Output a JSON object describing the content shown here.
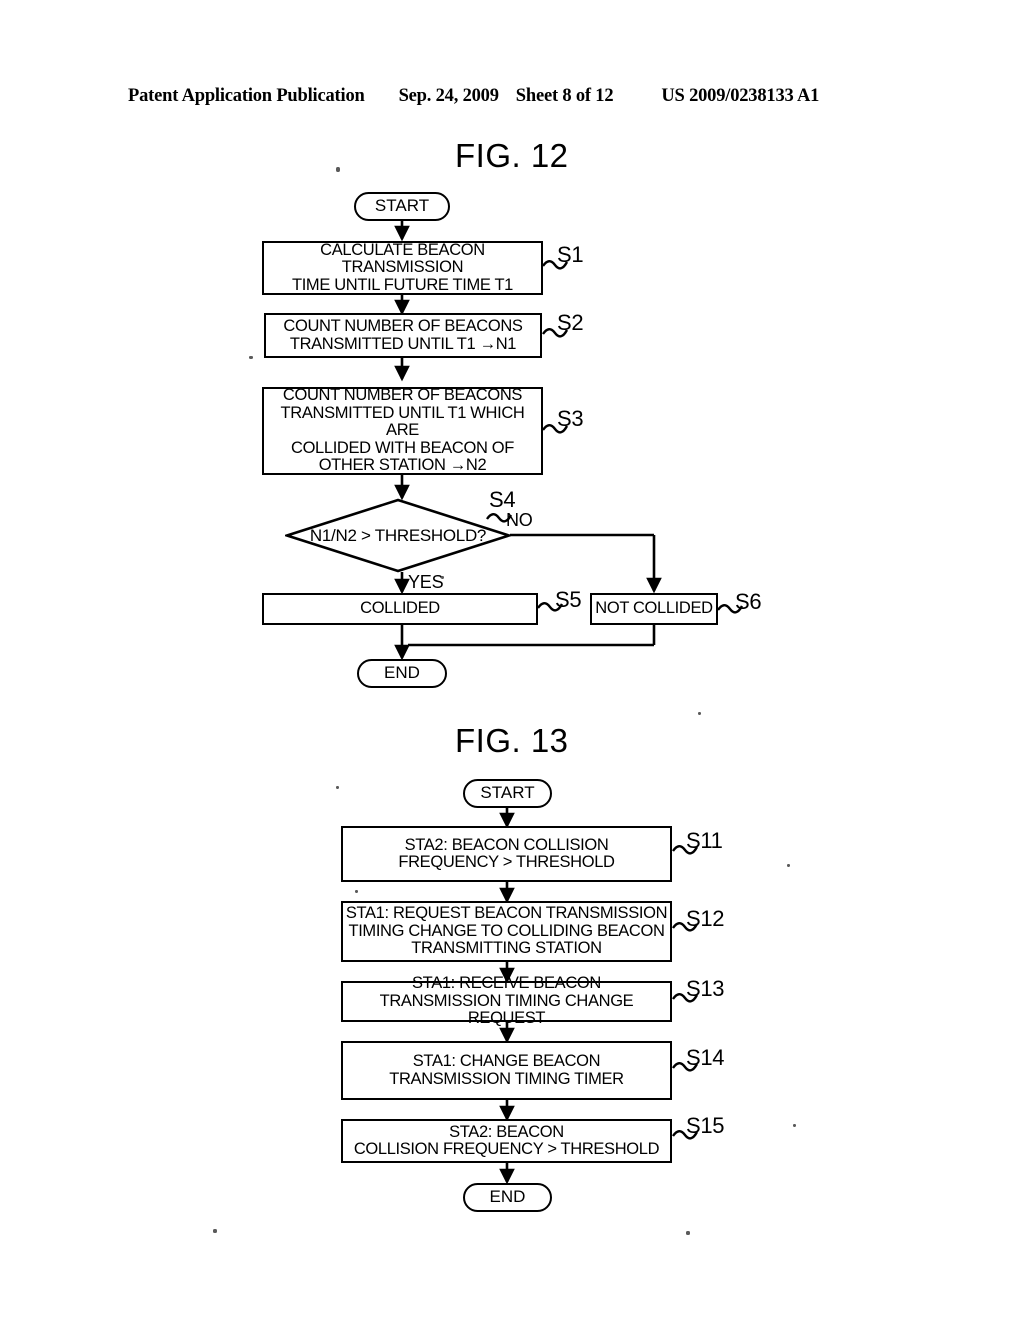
{
  "header": {
    "publication": "Patent Application Publication",
    "date": "Sep. 24, 2009",
    "sheet": "Sheet 8 of 12",
    "doc_number": "US 2009/0238133 A1"
  },
  "figures": [
    {
      "id": "fig12",
      "title": "FIG. 12",
      "nodes": {
        "start": "START",
        "s1": "CALCULATE BEACON TRANSMISSION\nTIME UNTIL FUTURE TIME T1",
        "s2": "COUNT NUMBER OF BEACONS\nTRANSMITTED UNTIL T1 →N1",
        "s3": "COUNT NUMBER OF BEACONS\nTRANSMITTED UNTIL T1 WHICH ARE\nCOLLIDED WITH BEACON OF\nOTHER STATION →N2",
        "s4": "N1/N2 > THRESHOLD?",
        "s5": "COLLIDED",
        "s6": "NOT COLLIDED",
        "end": "END"
      },
      "step_refs": {
        "s1": "S1",
        "s2": "S2",
        "s3": "S3",
        "s4": "S4",
        "s5": "S5",
        "s6": "S6"
      },
      "branches": {
        "yes": "YES",
        "no": "NO"
      }
    },
    {
      "id": "fig13",
      "title": "FIG. 13",
      "nodes": {
        "start": "START",
        "s11": "STA2: BEACON COLLISION\nFREQUENCY > THRESHOLD",
        "s12": "STA1: REQUEST BEACON TRANSMISSION\nTIMING CHANGE TO COLLIDING BEACON\nTRANSMITTING STATION",
        "s13": "STA1: RECEIVE BEACON\nTRANSMISSION TIMING CHANGE REQUEST",
        "s14": "STA1: CHANGE BEACON\nTRANSMISSION TIMING TIMER",
        "s15": "STA2: BEACON\nCOLLISION FREQUENCY > THRESHOLD",
        "end": "END"
      },
      "step_refs": {
        "s11": "S11",
        "s12": "S12",
        "s13": "S13",
        "s14": "S14",
        "s15": "S15"
      }
    }
  ],
  "colors": {
    "ink": "#000000",
    "paper": "#ffffff"
  }
}
